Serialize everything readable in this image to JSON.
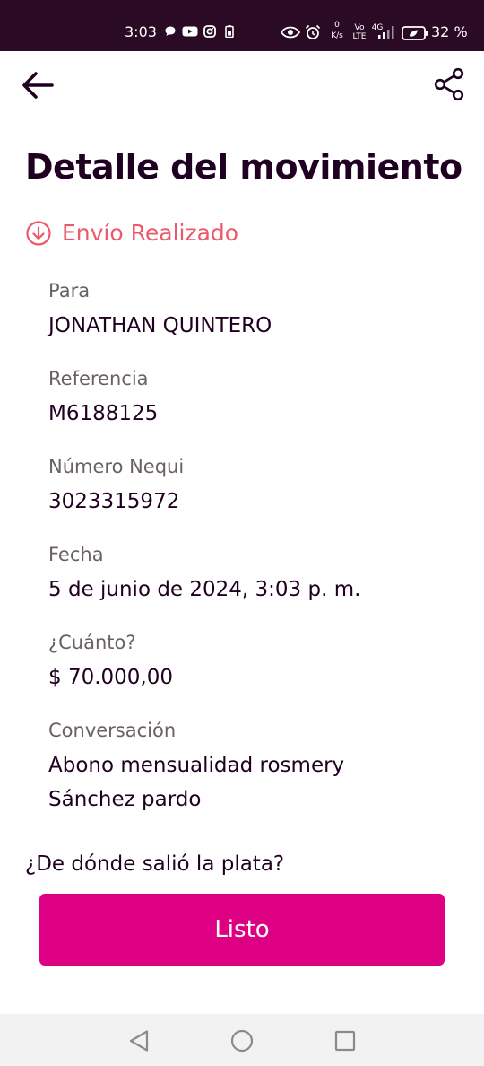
{
  "status_bar": {
    "time": "3:03",
    "battery": "32 %",
    "net_speed_value": "0",
    "net_speed_unit": "K/s",
    "volte_top": "Vo",
    "volte_bottom": "LTE",
    "network": "4G",
    "icons": [
      "chat-icon",
      "youtube-icon",
      "instagram-icon",
      "battery-saver-icon",
      "eye-icon",
      "alarm-icon",
      "signal-icon",
      "battery-icon"
    ]
  },
  "header": {
    "back_icon": "arrow-left-icon",
    "share_icon": "share-icon"
  },
  "page": {
    "title": "Detalle del movimiento",
    "status": "Envío Realizado",
    "status_color": "#ec5a6a"
  },
  "details": {
    "para_label": "Para",
    "para_value": "JONATHAN QUINTERO",
    "referencia_label": "Referencia",
    "referencia_value": "M6188125",
    "numero_label": "Número Nequi",
    "numero_value": "3023315972",
    "fecha_label": "Fecha",
    "fecha_value": "5 de junio de 2024, 3:03 p. m.",
    "cuanto_label": "¿Cuánto?",
    "cuanto_value": "$ 70.000,00",
    "conversacion_label": "Conversación",
    "conversacion_value": "Abono mensualidad rosmery Sánchez pardo"
  },
  "footer": {
    "question": "¿De dónde salió la plata?",
    "done_label": "Listo",
    "accent": "#de0082"
  },
  "nav": {
    "icons": [
      "back-triangle-icon",
      "home-circle-icon",
      "recents-square-icon"
    ]
  }
}
